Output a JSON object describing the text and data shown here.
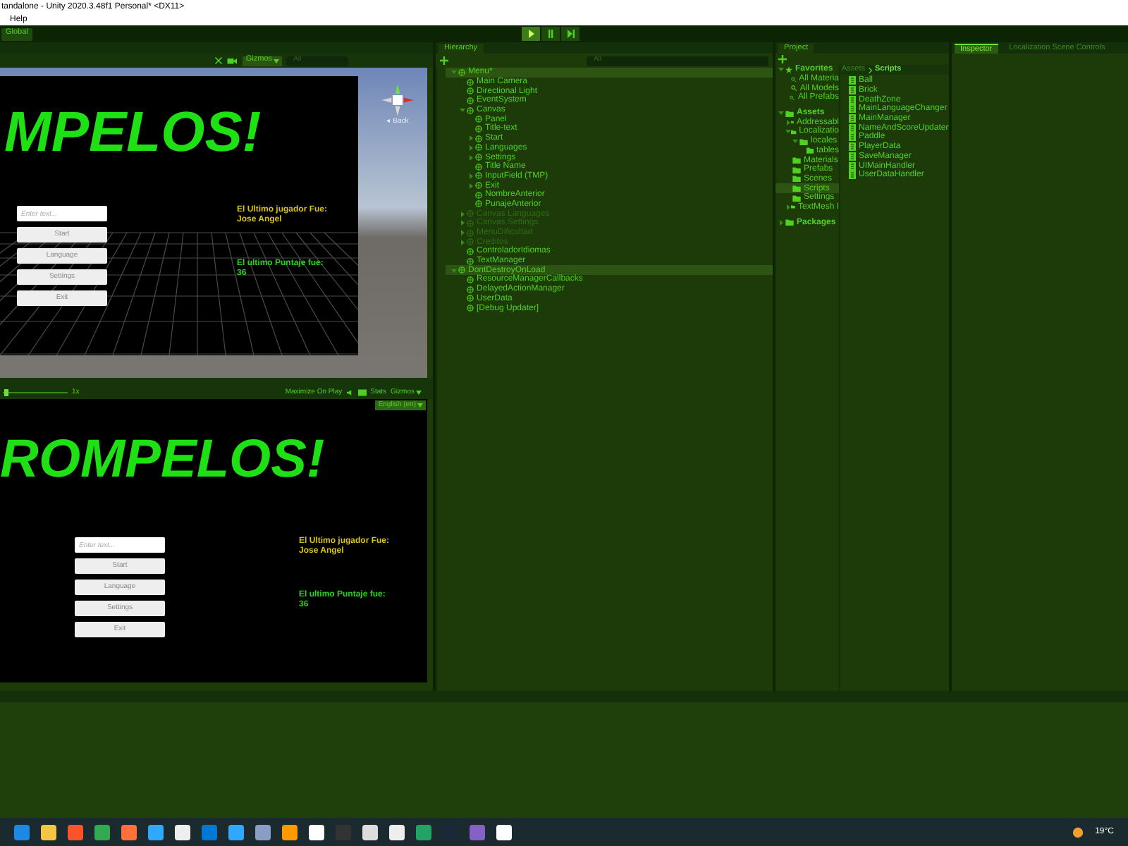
{
  "window": {
    "title": "tandalone - Unity 2020.3.48f1 Personal* <DX11>"
  },
  "menu": [
    "Help"
  ],
  "toolbar": {
    "global": "Global"
  },
  "scene_view": {
    "gizmos": "Gizmos",
    "search_placeholder": "All",
    "orientation_label": "◂ Back",
    "canvas": {
      "title": "MPELOS!",
      "input_placeholder": "Enter text...",
      "buttons": [
        "Start",
        "Language",
        "Settings",
        "Exit"
      ],
      "last_player_label": "El Ultimo jugador Fue:",
      "last_player": "Jose Angel",
      "last_score_label": "El ultimo Puntaje fue:",
      "last_score": "36"
    }
  },
  "game_view": {
    "scale": "1x",
    "scale_slider": {
      "level": 0.03
    },
    "maximize": "Maximize On Play",
    "stats": "Stats",
    "gizmos": "Gizmos",
    "language": "English (en)",
    "canvas": {
      "title": "ROMPELOS!",
      "input_placeholder": "Enter text...",
      "buttons": [
        "Start",
        "Language",
        "Settings",
        "Exit"
      ],
      "last_player_label": "El Ultimo jugador Fue:",
      "last_player": "Jose Angel",
      "last_score_label": "El ultimo Puntaje fue:",
      "last_score": "36"
    }
  },
  "hierarchy": {
    "title": "Hierarchy",
    "search_placeholder": "All",
    "items": [
      {
        "label": "Menu*",
        "kind": "scene",
        "expanded": true,
        "disabled": false,
        "children": [
          {
            "label": "Main Camera",
            "disabled": false
          },
          {
            "label": "Directional Light",
            "disabled": false
          },
          {
            "label": "EventSystem",
            "disabled": false
          },
          {
            "label": "Canvas",
            "expanded": true,
            "disabled": false,
            "children": [
              {
                "label": "Panel",
                "disabled": false
              },
              {
                "label": "Title-text",
                "disabled": false
              },
              {
                "label": "Start",
                "expanded": false,
                "disabled": false
              },
              {
                "label": "Languages",
                "expanded": false,
                "disabled": false
              },
              {
                "label": "Settings",
                "expanded": false,
                "disabled": false
              },
              {
                "label": "Title Name",
                "disabled": false
              },
              {
                "label": "InputField (TMP)",
                "expanded": false,
                "disabled": false
              },
              {
                "label": "Exit",
                "expanded": false,
                "disabled": false
              },
              {
                "label": "NombreAnterior",
                "disabled": false
              },
              {
                "label": "PunajeAnterior",
                "disabled": false
              }
            ]
          },
          {
            "label": "Canvas Languages",
            "expanded": false,
            "disabled": true
          },
          {
            "label": "Canvas Settings",
            "expanded": false,
            "disabled": true
          },
          {
            "label": "MenuDificultad",
            "expanded": false,
            "disabled": true
          },
          {
            "label": "Creditos",
            "expanded": false,
            "disabled": true
          },
          {
            "label": "ControladorIdiomas",
            "disabled": false
          },
          {
            "label": "TextManager",
            "disabled": false
          }
        ]
      },
      {
        "label": "DontDestroyOnLoad",
        "kind": "scene",
        "expanded": true,
        "disabled": false,
        "children": [
          {
            "label": "ResourceManagerCallbacks",
            "disabled": false
          },
          {
            "label": "DelayedActionManager",
            "disabled": false
          },
          {
            "label": "UserData",
            "disabled": false
          },
          {
            "label": "[Debug Updater]",
            "disabled": false
          }
        ]
      }
    ]
  },
  "project": {
    "title": "Project",
    "breadcrumb": [
      "Assets",
      "Scripts"
    ],
    "tree": [
      {
        "label": "Favorites",
        "kind": "favorites",
        "expanded": true,
        "selected": false,
        "children": [
          {
            "label": "All Materia",
            "kind": "search",
            "selected": false
          },
          {
            "label": "All Models",
            "kind": "search",
            "selected": false
          },
          {
            "label": "All Prefabs",
            "kind": "search",
            "selected": false
          }
        ]
      },
      {
        "label": "Assets",
        "kind": "folder",
        "expanded": true,
        "selected": false,
        "children": [
          {
            "label": "Addressabl",
            "kind": "folder",
            "expanded": false,
            "selected": false
          },
          {
            "label": "Localizatio",
            "kind": "folder",
            "expanded": true,
            "selected": false,
            "children": [
              {
                "label": "locales",
                "kind": "folder",
                "expanded": true,
                "selected": false,
                "children": [
                  {
                    "label": "tables",
                    "kind": "folder",
                    "selected": false
                  }
                ]
              }
            ]
          },
          {
            "label": "Materials",
            "kind": "folder",
            "selected": false
          },
          {
            "label": "Prefabs",
            "kind": "folder",
            "selected": false
          },
          {
            "label": "Scenes",
            "kind": "folder",
            "selected": false
          },
          {
            "label": "Scripts",
            "kind": "folder",
            "selected": true
          },
          {
            "label": "Settings",
            "kind": "folder",
            "selected": false
          },
          {
            "label": "TextMesh I",
            "kind": "folder",
            "expanded": false,
            "selected": false
          }
        ]
      },
      {
        "label": "Packages",
        "kind": "folder",
        "expanded": false,
        "selected": false
      }
    ],
    "files": [
      "Ball",
      "Brick",
      "DeathZone",
      "MainLanguageChanger",
      "MainManager",
      "NameAndScoreUpdater",
      "Paddle",
      "PlayerData",
      "SaveManager",
      "UIMainHandler",
      "UserDataHandler"
    ]
  },
  "inspector": {
    "tabs": [
      {
        "label": "Inspector",
        "selected": true
      },
      {
        "label": "Localization Scene Controls",
        "selected": false
      }
    ]
  },
  "taskbar": {
    "temperature": "19°C"
  }
}
